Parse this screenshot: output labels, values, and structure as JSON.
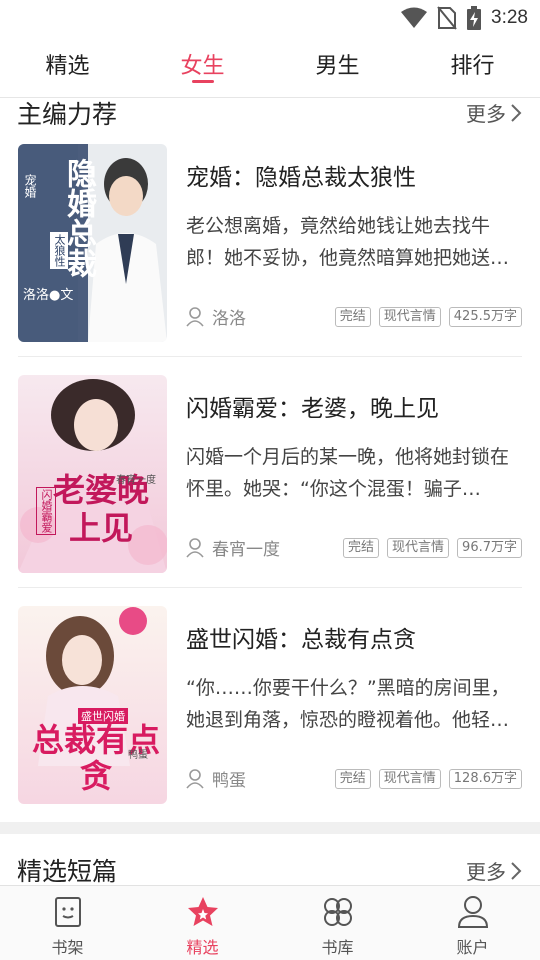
{
  "status_bar": {
    "time": "3:28",
    "icons": [
      "wifi-icon",
      "no-sim-icon",
      "battery-charging-icon"
    ]
  },
  "top_tabs": [
    {
      "label": "精选",
      "active": false
    },
    {
      "label": "女生",
      "active": true
    },
    {
      "label": "男生",
      "active": false
    },
    {
      "label": "排行",
      "active": false
    }
  ],
  "accent_color": "#e8425f",
  "sections": {
    "editor_picks": {
      "title": "主编力荐",
      "more": "更多"
    },
    "short_picks": {
      "title": "精选短篇",
      "more": "更多"
    }
  },
  "books": [
    {
      "title": "宠婚：隐婚总裁太狼性",
      "description": "老公想离婚，竟然给她钱让她去找牛郎！她不妥协，他竟然暗算她把她送…",
      "author": "洛洛",
      "tags": [
        "完结",
        "现代言情",
        "425.5万字"
      ],
      "cover_text": {
        "main": "隐婚总裁",
        "sub": "宠婚",
        "tag": "太狼性",
        "author": "洛洛●文"
      }
    },
    {
      "title": "闪婚霸爱：老婆，晚上见",
      "description": "闪婚一个月后的某一晚，他将她封锁在怀里。她哭：“你这个混蛋！骗子…",
      "author": "春宵一度",
      "tags": [
        "完结",
        "现代言情",
        "96.7万字"
      ],
      "cover_text": {
        "main": "老婆晚上见",
        "sub": "闪婚霸爱",
        "author": "春宵一度"
      }
    },
    {
      "title": "盛世闪婚：总裁有点贪",
      "description": "“你……你要干什么？”黑暗的房间里，她退到角落，惊恐的瞪视着他。他轻…",
      "author": "鸭蛋",
      "tags": [
        "完结",
        "现代言情",
        "128.6万字"
      ],
      "cover_text": {
        "main": "总裁有点贪",
        "sub": "盛世闪婚",
        "author": "鸭蛋"
      }
    }
  ],
  "bottom_nav": [
    {
      "label": "书架",
      "icon": "bookshelf-icon",
      "active": false
    },
    {
      "label": "精选",
      "icon": "star-icon",
      "active": true
    },
    {
      "label": "书库",
      "icon": "library-icon",
      "active": false
    },
    {
      "label": "账户",
      "icon": "account-icon",
      "active": false
    }
  ]
}
